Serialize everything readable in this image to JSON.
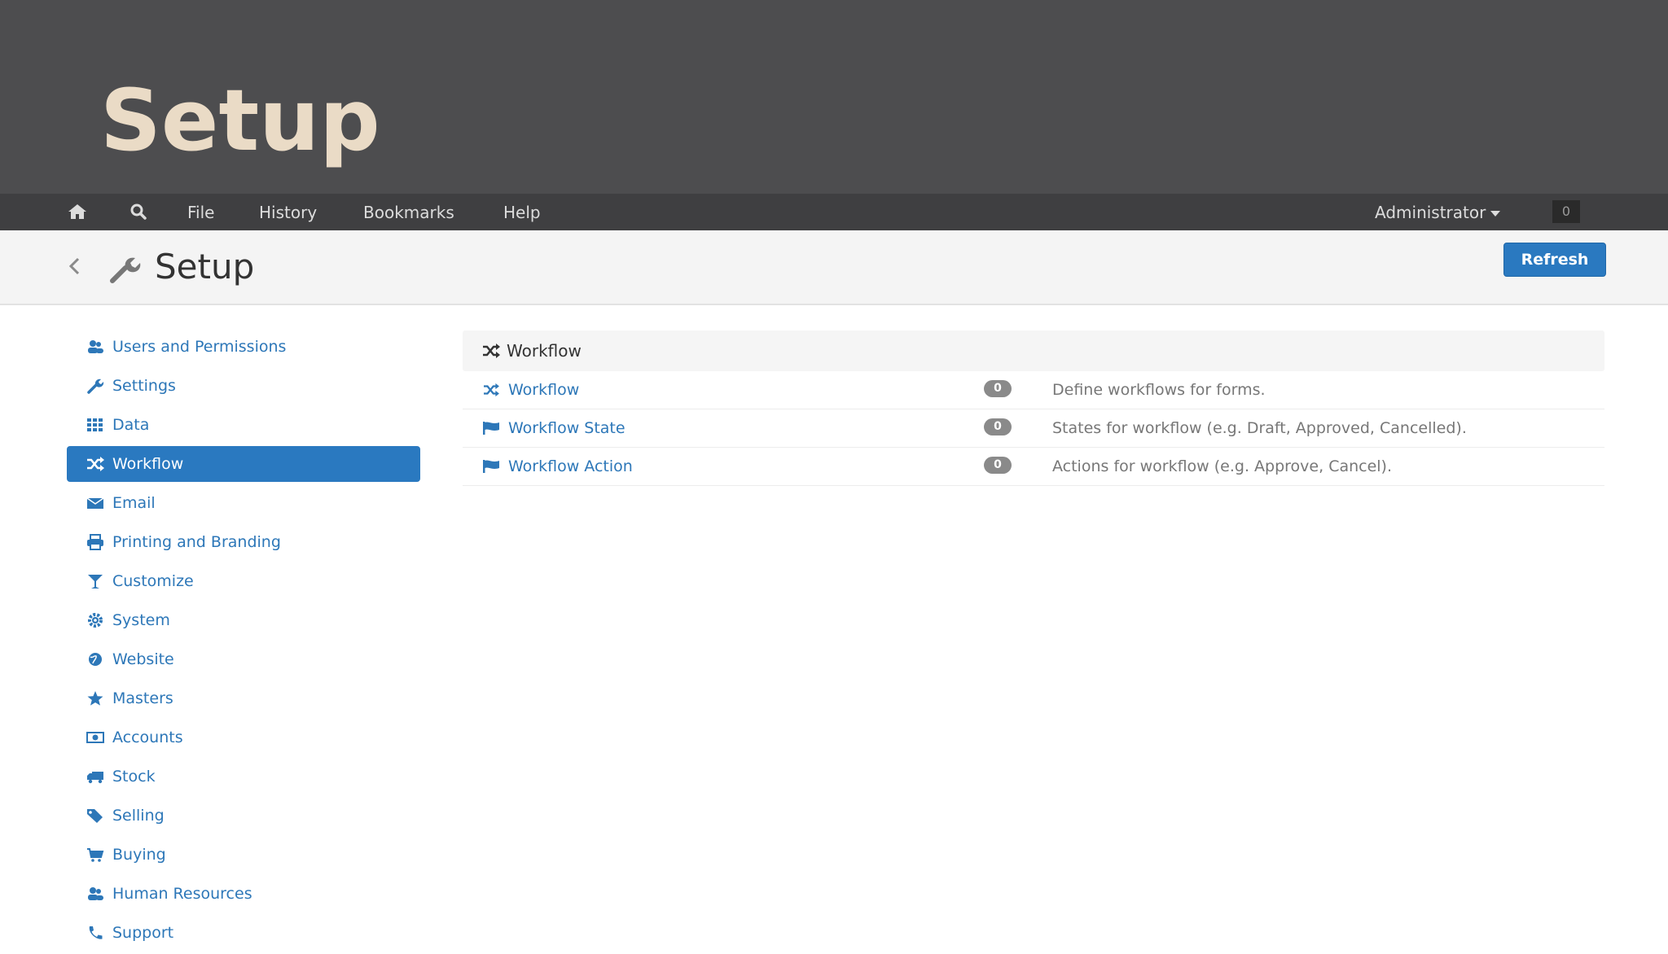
{
  "slide": {
    "title": "Setup"
  },
  "navbar": {
    "menu": [
      "File",
      "History",
      "Bookmarks",
      "Help"
    ],
    "user": "Administrator",
    "notification_count": "0"
  },
  "page": {
    "title": "Setup",
    "refresh_label": "Refresh"
  },
  "sidebar": {
    "items": [
      {
        "label": "Users and Permissions",
        "icon": "users-icon"
      },
      {
        "label": "Settings",
        "icon": "wrench-icon"
      },
      {
        "label": "Data",
        "icon": "grid-icon"
      },
      {
        "label": "Workflow",
        "icon": "shuffle-icon",
        "active": true
      },
      {
        "label": "Email",
        "icon": "envelope-icon"
      },
      {
        "label": "Printing and Branding",
        "icon": "print-icon"
      },
      {
        "label": "Customize",
        "icon": "glass-icon"
      },
      {
        "label": "System",
        "icon": "cog-icon"
      },
      {
        "label": "Website",
        "icon": "globe-icon"
      },
      {
        "label": "Masters",
        "icon": "star-icon"
      },
      {
        "label": "Accounts",
        "icon": "money-icon"
      },
      {
        "label": "Stock",
        "icon": "truck-icon"
      },
      {
        "label": "Selling",
        "icon": "tag-icon"
      },
      {
        "label": "Buying",
        "icon": "cart-icon"
      },
      {
        "label": "Human Resources",
        "icon": "users-icon"
      },
      {
        "label": "Support",
        "icon": "phone-icon"
      }
    ]
  },
  "panel": {
    "title": "Workflow",
    "rows": [
      {
        "name": "Workflow",
        "count": "0",
        "desc": "Define workflows for forms.",
        "icon": "shuffle-icon"
      },
      {
        "name": "Workflow State",
        "count": "0",
        "desc": "States for workflow (e.g. Draft, Approved, Cancelled).",
        "icon": "flag-icon"
      },
      {
        "name": "Workflow Action",
        "count": "0",
        "desc": "Actions for workflow (e.g. Approve, Cancel).",
        "icon": "flag-icon"
      }
    ]
  },
  "colors": {
    "accent": "#2a79c0",
    "link": "#2d77b8",
    "slide_bg": "#4d4d4f",
    "title_color": "#eadbc6"
  }
}
